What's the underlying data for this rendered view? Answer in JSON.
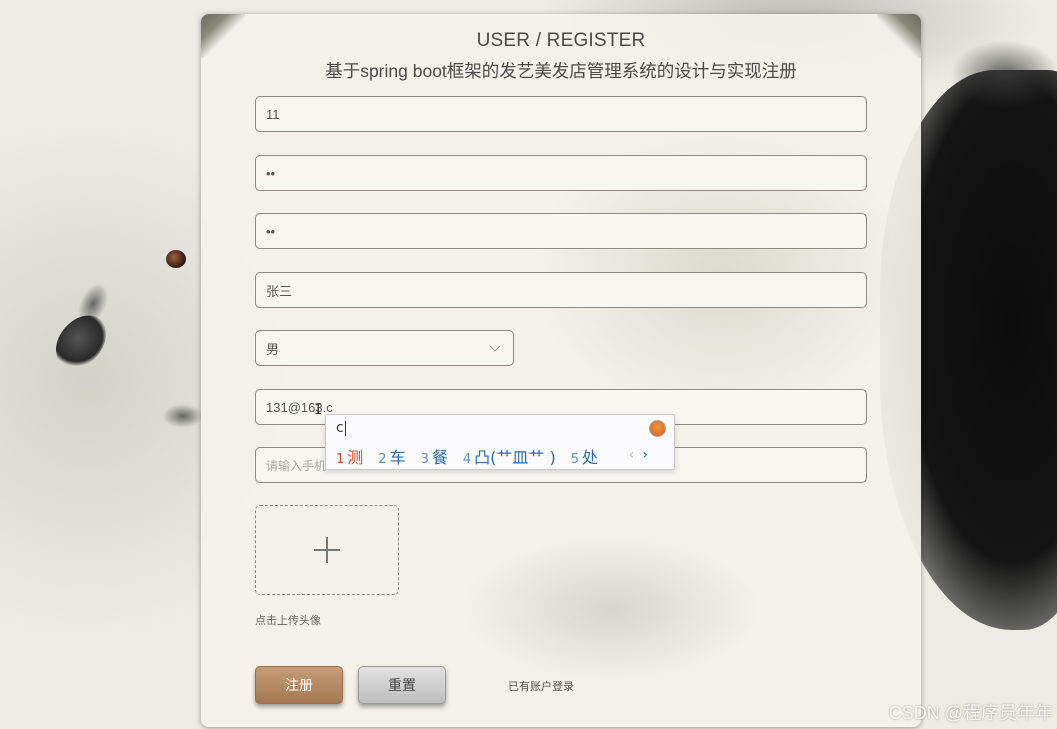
{
  "header": {
    "title": "USER / REGISTER",
    "subtitle": "基于spring boot框架的发艺美发店管理系统的设计与实现注册"
  },
  "form": {
    "username_value": "11",
    "password_value": "••",
    "confirm_password_value": "••",
    "name_value": "张三",
    "gender_selected": "男",
    "email_value": "131@163.c",
    "phone_placeholder": "请输入手机",
    "upload_hint": "点击上传头像"
  },
  "actions": {
    "register_label": "注册",
    "reset_label": "重置",
    "login_link": "已有账户登录"
  },
  "ime": {
    "composition": "c",
    "candidates": [
      {
        "num": "1",
        "text": "测"
      },
      {
        "num": "2",
        "text": "车"
      },
      {
        "num": "3",
        "text": "餐"
      },
      {
        "num": "4",
        "text": "凸(艹皿艹 )"
      },
      {
        "num": "5",
        "text": "处"
      }
    ],
    "prev": "‹",
    "next": "›"
  },
  "watermark": "CSDN @程序员年年",
  "colors": {
    "register_button": "#b38862",
    "candidate_active": "#d2492a",
    "candidate_text": "#2b6bb3"
  },
  "icons": [
    "plus-icon",
    "chevron-down-icon",
    "ime-logo-icon",
    "text-cursor-icon"
  ]
}
